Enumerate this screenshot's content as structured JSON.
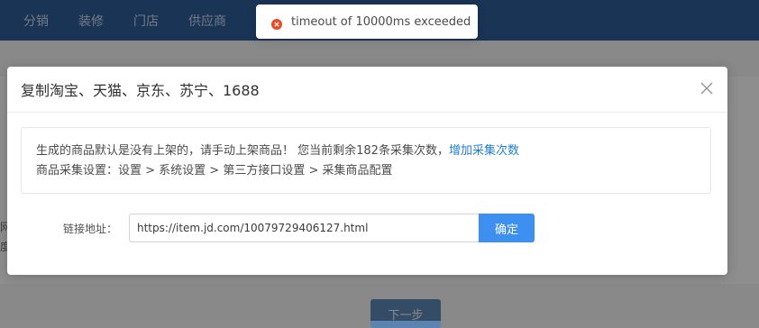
{
  "nav": {
    "items": [
      "分销",
      "装修",
      "门店",
      "供应商"
    ]
  },
  "background": {
    "next_button": "下一步",
    "fragment_1": "网",
    "fragment_2": "度"
  },
  "dialog": {
    "title": "复制淘宝、天猫、京东、苏宁、1688",
    "notice_line1": "生成的商品默认是没有上架的，请手动上架商品！ 您当前剩余182条采集次数，",
    "notice_link": "增加采集次数",
    "notice_line2": "商品采集设置：设置 > 系统设置 > 第三方接口设置 > 采集商品配置",
    "form_label": "链接地址：",
    "url_value": "https://item.jd.com/10079729406127.html",
    "confirm_label": "确定"
  },
  "toast": {
    "message": "timeout of 10000ms exceeded",
    "icon": "error-circle-icon"
  },
  "colors": {
    "topbar": "#2e5b94",
    "primary_button": "#3d8ff0",
    "link": "#1f7fd9",
    "error": "#ea4a24"
  }
}
